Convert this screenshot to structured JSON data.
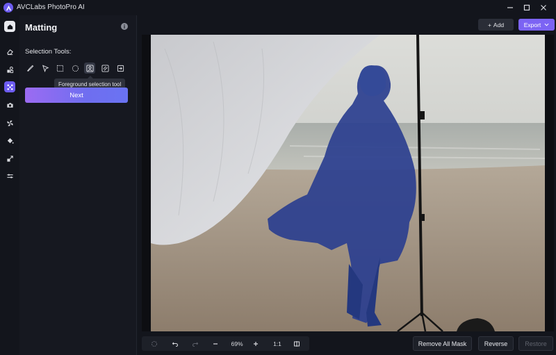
{
  "app": {
    "title": "AVCLabs PhotoPro AI"
  },
  "rail": {
    "items": [
      {
        "name": "home-icon",
        "active": false
      },
      {
        "name": "eraser-icon",
        "active": false
      },
      {
        "name": "shapes-icon",
        "active": false
      },
      {
        "name": "matting-icon",
        "active": true
      },
      {
        "name": "face-icon",
        "active": false
      },
      {
        "name": "fan-icon",
        "active": false
      },
      {
        "name": "fill-icon",
        "active": false
      },
      {
        "name": "upscale-icon",
        "active": false
      },
      {
        "name": "adjust-icon",
        "active": false
      }
    ]
  },
  "panel": {
    "title": "Matting",
    "section_label": "Selection Tools:",
    "tools": [
      "brush-icon",
      "pointer-icon",
      "rectangle-select-icon",
      "ellipse-select-icon",
      "foreground-select-icon",
      "background-select-icon",
      "import-icon"
    ],
    "tooltip": "Foreground selection tool",
    "next_label": "Next"
  },
  "top_actions": {
    "add_label": "Add",
    "export_label": "Export"
  },
  "bottom": {
    "zoom_level": "69%",
    "one_to_one": "1:1",
    "remove_all_mask": "Remove All Mask",
    "reverse": "Reverse",
    "restore": "Restore"
  },
  "colors": {
    "accent": "#6d5cf0",
    "mask": "#2b3f8f"
  }
}
